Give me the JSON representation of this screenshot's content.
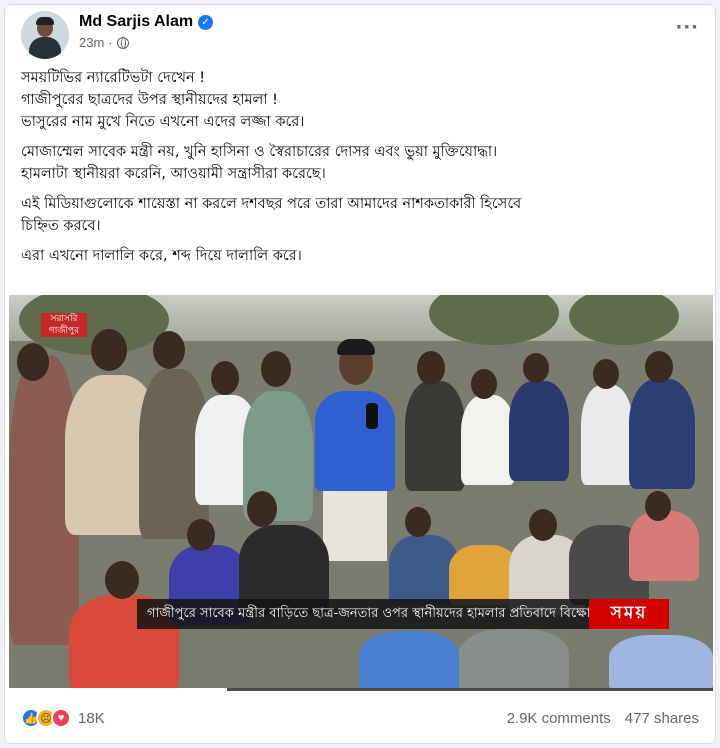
{
  "post": {
    "author": "Md Sarjis Alam",
    "time": "23m",
    "more_label": "···",
    "paragraphs": [
      {
        "lines": [
          "সময়টিভির ন্যারেটিভটা দেখেন !",
          "গাজীপুরের ছাত্রদের উপর স্থানীয়দের হামলা !",
          "ভাসুরের নাম মুখে নিতে এখনো এদের লজ্জা করে।"
        ]
      },
      {
        "lines": [
          "মোজাম্মেল সাবেক মন্ত্রী নয়, খুনি হাসিনা ও স্বৈরাচারের দোসর এবং ভুয়া মুক্তিযোদ্ধা।",
          "হামলাটা স্থানীয়রা করেনি, আওয়ামী সন্ত্রাসীরা করেছে।"
        ]
      },
      {
        "lines": [
          "এই মিডিয়াগুলোকে শায়েস্তা না করলে দশবছর পরে তারা আমাদের নাশকতাকারী হিসেবে",
          "চিহ্নিত করবে।"
        ]
      },
      {
        "lines": [
          "এরা এখনো দালালি করে, শব্দ দিয়ে দালালি করে।"
        ]
      }
    ]
  },
  "video": {
    "top_logo_lines": [
      "সরাসরি",
      "গাজীপুর"
    ],
    "ticker": "গাজীপুরে সাবেক মন্ত্রীর বাড়িতে ছাত্র-জনতার ওপর স্থানীয়দের হামলার প্রতিবাদে বিক্ষোভ",
    "brand": "সময়",
    "progress": 0.31
  },
  "stats": {
    "reactions": [
      "like-icon",
      "sad-icon",
      "love-icon"
    ],
    "reaction_count": "18K",
    "comments": "2.9K comments",
    "shares": "477 shares"
  },
  "colors": {
    "accent": "#1877f2",
    "brand_red": "#d50000",
    "text": "#050505",
    "secondary": "#65676b"
  }
}
